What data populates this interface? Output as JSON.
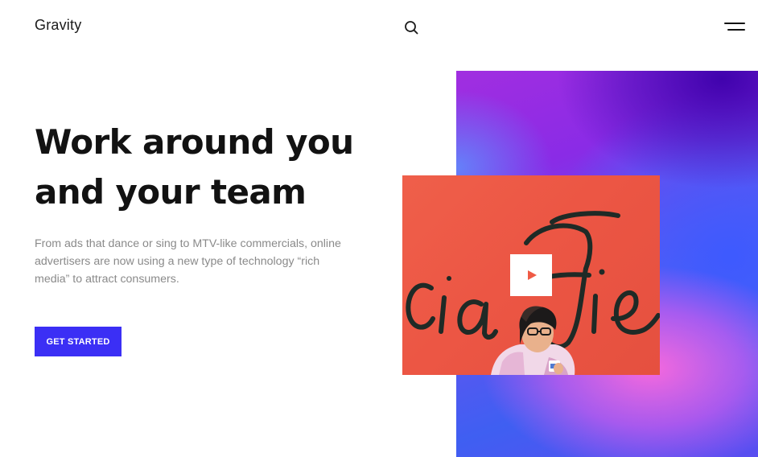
{
  "header": {
    "brand": "Gravity",
    "search_icon": "search-icon",
    "menu_icon": "menu-icon"
  },
  "hero": {
    "headline_line1": "Work around you",
    "headline_line2": "and your team",
    "subtitle": "From ads that dance or sing to MTV-like commercials, online advertisers are now using a new type of technology “rich media” to attract consumers.",
    "cta_label": "GET STARTED"
  },
  "media": {
    "play_icon": "play-icon"
  },
  "colors": {
    "accent": "#3b2ff5",
    "video_background": "#ef5f4a",
    "text_muted": "#8a8a8a",
    "headline": "#121212"
  }
}
